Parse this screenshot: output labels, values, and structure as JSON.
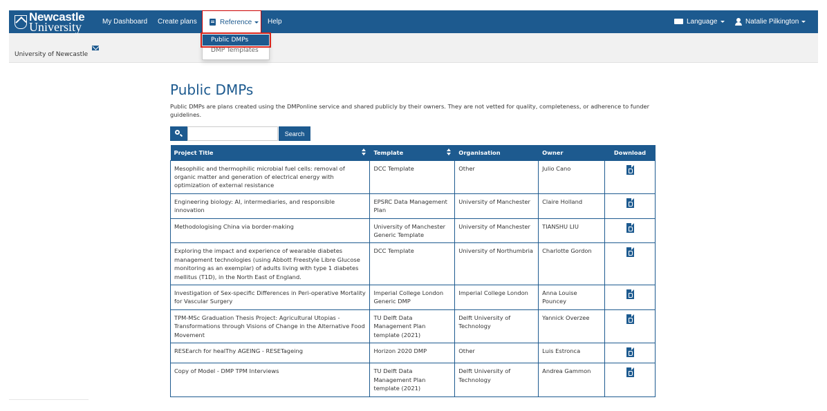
{
  "navbar": {
    "brand_line1": "Newcastle",
    "brand_line2": "University",
    "items": {
      "dashboard": "My Dashboard",
      "create_plans": "Create plans",
      "reference": "Reference",
      "help": "Help",
      "language": "Language",
      "user": "Natalie Pilkington"
    }
  },
  "subbar": {
    "org": "University of Newcastle"
  },
  "dropdown": {
    "items": [
      "Public DMPs",
      "DMP Templates"
    ]
  },
  "page": {
    "title": "Public DMPs",
    "intro": "Public DMPs are plans created using the DMPonline service and shared publicly by their owners. They are not vetted for quality, completeness, or adherence to funder guidelines."
  },
  "search": {
    "placeholder": "",
    "button": "Search"
  },
  "table": {
    "headers": [
      "Project Title",
      "Template",
      "Organisation",
      "Owner",
      "Download"
    ],
    "rows": [
      [
        "Mesophilic and thermophilic microbial fuel cells: removal of organic matter and generation of electrical energy with optimization of external resistance",
        "DCC Template",
        "Other",
        "Julio Cano"
      ],
      [
        "Engineering biology: AI, intermediaries, and responsible innovation",
        "EPSRC Data Management Plan",
        "University of Manchester",
        "Claire Holland"
      ],
      [
        "Methodologising China via border-making",
        "University of Manchester Generic Template",
        "University of Manchester",
        "TIANSHU LIU"
      ],
      [
        "Exploring the impact and experience of wearable diabetes management technologies (using Abbott Freestyle Libre Glucose monitoring as an exemplar) of adults living with type 1 diabetes mellitus (T1D), in the North East of England.",
        "DCC Template",
        "University of Northumbria",
        "Charlotte Gordon"
      ],
      [
        "Investigation of Sex-specific Differences in Peri-operative Mortality for Vascular Surgery",
        "Imperial College London Generic DMP",
        "Imperial College London",
        "Anna Louise Pouncey"
      ],
      [
        "TPM-MSc Graduation Thesis Project: Agricultural Utopias - Transformations through Visions of Change in the Alternative Food Movement",
        "TU Delft Data Management Plan template (2021)",
        "Delft University of Technology",
        "Yannick Overzee"
      ],
      [
        "RESEarch for healThy AGEING - RESETageing",
        "Horizon 2020 DMP",
        "Other",
        "Luis Estronca"
      ],
      [
        "Copy of Model - DMP TPM Interviews",
        "TU Delft Data Management Plan template (2021)",
        "Delft University of Technology",
        "Andrea Gammon"
      ]
    ]
  },
  "colors": {
    "primary": "#1d5a8f",
    "highlight": "#d9261c"
  }
}
